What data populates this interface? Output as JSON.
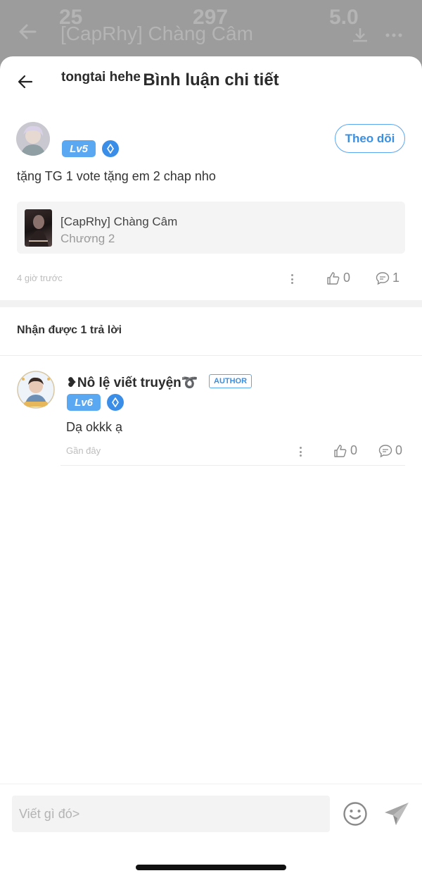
{
  "background": {
    "stat_left": "25",
    "stat_mid": "297",
    "rating": "5.0",
    "title": "[CapRhy] Chàng Câm"
  },
  "sheet": {
    "title": "Bình luận chi tiết"
  },
  "comment": {
    "username": "tongtai hehe",
    "level": "Lv5",
    "follow_label": "Theo dõi",
    "text": "tặng TG 1 vote tặng em 2 chap nho",
    "story_title": "[CapRhy] Chàng Câm",
    "chapter": "Chương 2",
    "time": "4 giờ trước",
    "likes": "0",
    "replies": "1"
  },
  "replies_heading": "Nhận được 1 trả lời",
  "reply": {
    "username": "❥Nô lệ viết truyện➰",
    "author_tag": "AUTHOR",
    "level": "Lv6",
    "text": "Dạ okkk ạ",
    "time": "Gần đây",
    "likes": "0",
    "replies": "0"
  },
  "input": {
    "placeholder": "Viết gì đó>"
  },
  "colors": {
    "accent": "#5aa7f2",
    "overlay": "#8a8a8a"
  }
}
